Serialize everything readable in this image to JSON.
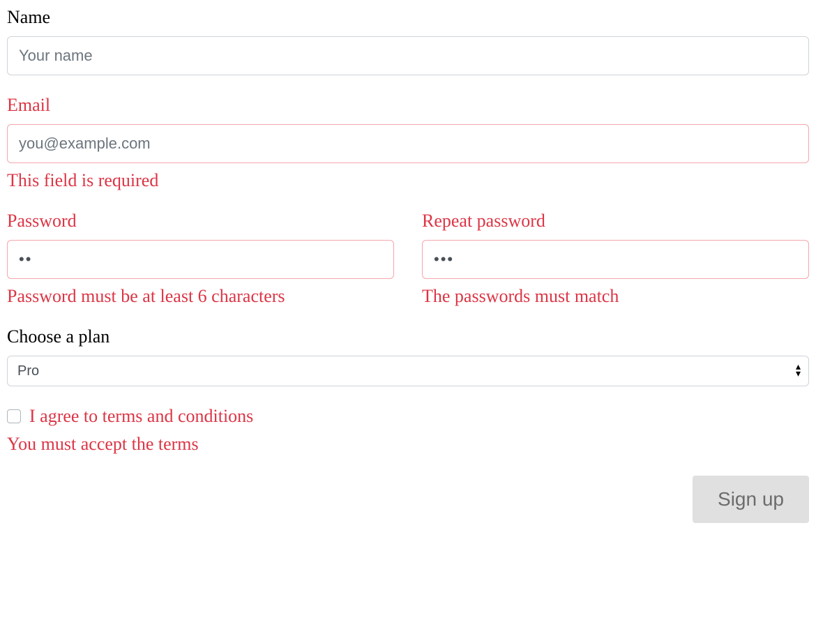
{
  "name": {
    "label": "Name",
    "placeholder": "Your name",
    "value": ""
  },
  "email": {
    "label": "Email",
    "placeholder": "you@example.com",
    "value": "",
    "error": "This field is required"
  },
  "password": {
    "label": "Password",
    "value": "ab",
    "error": "Password must be at least 6 characters"
  },
  "repeat_password": {
    "label": "Repeat password",
    "value": "abc",
    "error": "The passwords must match"
  },
  "plan": {
    "label": "Choose a plan",
    "selected": "Pro"
  },
  "terms": {
    "label": "I agree to terms and conditions",
    "checked": false,
    "error": "You must accept the terms"
  },
  "submit": {
    "label": "Sign up"
  }
}
